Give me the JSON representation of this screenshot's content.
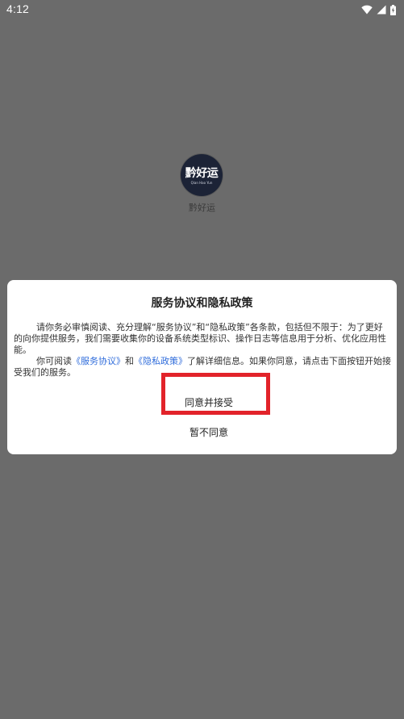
{
  "status_bar": {
    "time": "4:12",
    "icons": [
      "wifi-icon",
      "cellular-signal-icon",
      "battery-icon"
    ]
  },
  "splash": {
    "logo_text": "黔好运",
    "logo_subtext": "Qian Hao Yun",
    "app_name": "黔好运"
  },
  "dialog": {
    "title": "服务协议和隐私政策",
    "paragraph1": "请你务必审慎阅读、充分理解“服务协议”和“隐私政策”各条款，包括但不限于：为了更好的向你提供服务，我们需要收集你的设备系统类型标识、操作日志等信息用于分析、优化应用性能。",
    "paragraph2_prefix": "你可阅读",
    "service_link": "《服务协议》",
    "paragraph2_and": "和",
    "privacy_link": "《隐私政策》",
    "paragraph2_suffix": "了解详细信息。如果你同意，请点击下面按钮开始接受我们的服务。",
    "agree_label": "同意并接受",
    "disagree_label": "暂不同意"
  },
  "colors": {
    "overlay": "#6b6b6b",
    "link": "#2f6cdb",
    "highlight": "#e2232a",
    "dialog_bg": "#ffffff"
  }
}
